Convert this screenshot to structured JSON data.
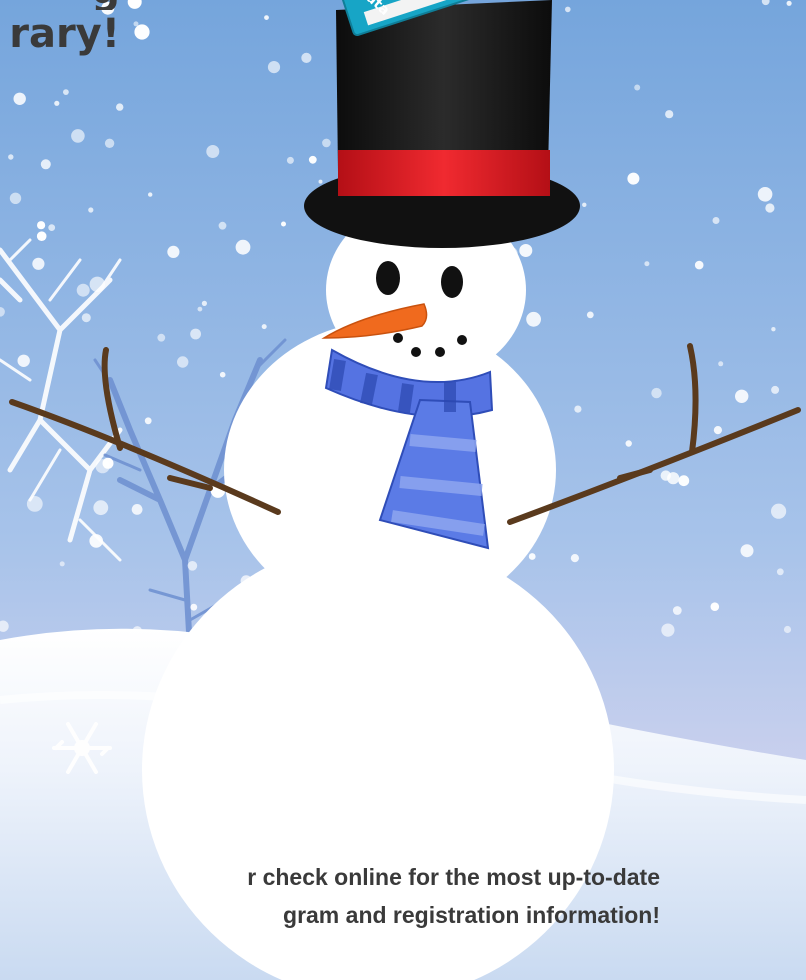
{
  "headline": {
    "line1": "g",
    "line2": "rary!"
  },
  "book_label": "ata",
  "footer": {
    "line1": "r check online for the most up-to-date",
    "line2": "gram and registration information!"
  },
  "icons": [
    "snowman",
    "top-hat",
    "book",
    "scarf",
    "snowflake",
    "tree"
  ],
  "colors": {
    "sky_top": "#77a6dc",
    "sky_bottom": "#e5d9ef",
    "snow": "#ffffff",
    "hat": "#151515",
    "hat_band": "#d81820",
    "scarf": "#4f6fe0",
    "nose": "#f06a1e",
    "arms": "#5b3a1c",
    "text": "#3a3a3a"
  }
}
